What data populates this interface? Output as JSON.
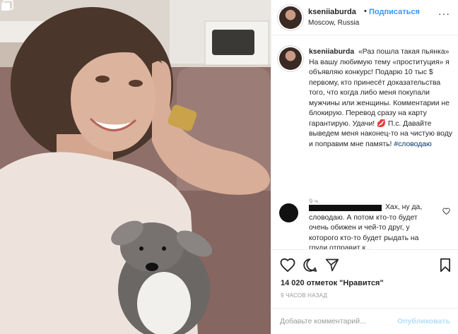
{
  "post": {
    "username": "kseniiaburda",
    "follow_label": "Подписаться",
    "separator": "•",
    "location": "Moscow, Russia",
    "more_label": "···"
  },
  "caption": {
    "username": "kseniiaburda",
    "text": "«Раз пошла такая пьянка» На вашу любимую тему «проституция» я объявляю конкурс! Подарю 10 тыс $ первому, кто принесёт доказательства того, что когда либо меня покупали мужчины или женщины. Комментарии не блокирую. Перевод сразу на карту гарантирую. Удачи! 💋 П.с. Давайте выведем меня наконец-то на чистую воду и поправим мне память!",
    "hashtag": "#словодаю",
    "time": "9 ч."
  },
  "comment": {
    "text": "Хах, ну да, словодаю. А потом кто-то будет очень обижен и чей-то друг, у которого кто-то будет рыдать на груди отправит к..."
  },
  "actions": {
    "likes": "14 020 отметок \"Нравится\"",
    "posted": "9 ЧАСОВ НАЗАД"
  },
  "add_comment": {
    "placeholder": "Добавьте комментарий...",
    "publish_label": "Опубликовать"
  },
  "icons": {
    "carousel": "carousel-icon",
    "like": "heart-icon",
    "comment": "comment-icon",
    "share": "share-icon",
    "save": "bookmark-icon",
    "comment_like": "heart-icon"
  },
  "colors": {
    "follow": "#3897f0",
    "publish_disabled": "#b2dffc",
    "hashtag": "#003569",
    "muted": "#999999"
  }
}
